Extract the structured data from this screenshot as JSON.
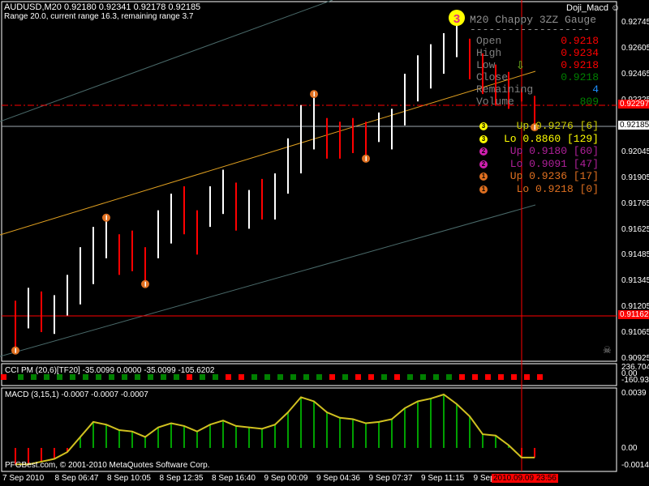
{
  "header": {
    "symbol_line": "AUDUSD,M20  0.92180 0.92341 0.92178 0.92185",
    "range_line": "Range 20.0, current range 16.3, remaining range 3.7",
    "expert": "Doji_Macd ☺"
  },
  "gauge": {
    "title": "M20 Chappy 3ZZ Gauge",
    "dash": "-------------------",
    "rows": [
      {
        "label": "Open",
        "value": "0.9218",
        "color": "#ff0000"
      },
      {
        "label": "High",
        "value": "0.9234",
        "color": "#ff0000"
      },
      {
        "label": "Low",
        "value": "0.9218",
        "color": "#ff0000"
      },
      {
        "label": "Close",
        "value": "0.9218",
        "color": "#008000"
      },
      {
        "label": "Remaining",
        "value": "4",
        "color": "#1e90ff"
      },
      {
        "label": "Volume",
        "value": "809",
        "color": "#008000"
      }
    ],
    "levels": [
      {
        "badge": "3",
        "text": "Up 0.9276 [6]",
        "color": "#cccc00",
        "badge_color": "#ffff00"
      },
      {
        "badge": "3",
        "text": "Lo 0.8860 [129]",
        "color": "#ffff00",
        "badge_color": "#ffff00"
      },
      {
        "badge": "2",
        "text": "Up 0.9180 [60]",
        "color": "#b0209a",
        "badge_color": "#d020b0"
      },
      {
        "badge": "2",
        "text": "Lo 0.9091 [47]",
        "color": "#b0209a",
        "badge_color": "#d020b0"
      },
      {
        "badge": "1",
        "text": "Up 0.9236 [17]",
        "color": "#e07020",
        "badge_color": "#e07020"
      },
      {
        "badge": "1",
        "text": "Lo 0.9218 [0]",
        "color": "#e07020",
        "badge_color": "#e07020"
      }
    ],
    "big_badge": "3"
  },
  "price_axis": [
    "0.92745",
    "0.92605",
    "0.92465",
    "0.92325",
    "0.92185",
    "0.92045",
    "0.91905",
    "0.91765",
    "0.91625",
    "0.91485",
    "0.91345",
    "0.91205",
    "0.91065",
    "0.90925"
  ],
  "price_tags": {
    "dashed": "0.92297",
    "current": "0.92185",
    "red": "0.91162"
  },
  "cci": {
    "label": "CCI PM (20,6)[TF20] -35.0099 0.0000 -35.0099 -105.6202",
    "axis": [
      "236.7045",
      "0.00",
      "-160.931"
    ],
    "colors": "rgggggggggggggrggrrggggggrgrrgrggggrrrrrrr"
  },
  "macd": {
    "label": "MACD (3,15,1) -0.0007 -0.0007 -0.0007",
    "axis": [
      "0.0039",
      "0.00",
      "-0.0014"
    ],
    "values": [
      -0.0012,
      -0.0012,
      -0.001,
      -0.0008,
      -0.0003,
      0.0008,
      0.0019,
      0.0017,
      0.0013,
      0.0012,
      0.0008,
      0.0015,
      0.0018,
      0.0016,
      0.0012,
      0.0017,
      0.002,
      0.0016,
      0.0015,
      0.0014,
      0.0017,
      0.0026,
      0.0037,
      0.0034,
      0.0026,
      0.0022,
      0.0021,
      0.0018,
      0.0019,
      0.0021,
      0.0029,
      0.0034,
      0.0036,
      0.0039,
      0.0032,
      0.0023,
      0.001,
      0.0009,
      0.0002,
      -0.0007,
      -0.0007
    ]
  },
  "copyright": "PFGBest.com, © 2001-2010 MetaQuotes Software Corp.",
  "time_axis": [
    "7 Sep 2010",
    "8 Sep 06:47",
    "8 Sep 10:05",
    "8 Sep 12:35",
    "8 Sep 16:40",
    "9 Sep 00:09",
    "9 Sep 04:36",
    "9 Sep 07:37",
    "9 Sep 11:15",
    "9 Sep"
  ],
  "time_cursor": "2010.09.09 23:56",
  "candles": [
    [
      0.9124,
      0.9096,
      0
    ],
    [
      0.9131,
      0.9109,
      1
    ],
    [
      0.9129,
      0.9107,
      0
    ],
    [
      0.9127,
      0.9106,
      1
    ],
    [
      0.9138,
      0.9116,
      1
    ],
    [
      0.9153,
      0.9122,
      1
    ],
    [
      0.9164,
      0.9133,
      1
    ],
    [
      0.9169,
      0.9147,
      1
    ],
    [
      0.916,
      0.9138,
      0
    ],
    [
      0.9162,
      0.914,
      0
    ],
    [
      0.9153,
      0.9132,
      0
    ],
    [
      0.9173,
      0.9147,
      1
    ],
    [
      0.9182,
      0.9155,
      1
    ],
    [
      0.9186,
      0.916,
      0
    ],
    [
      0.9173,
      0.9149,
      0
    ],
    [
      0.9186,
      0.9164,
      1
    ],
    [
      0.9195,
      0.9171,
      1
    ],
    [
      0.9188,
      0.9162,
      0
    ],
    [
      0.9184,
      0.9163,
      1
    ],
    [
      0.919,
      0.9168,
      0
    ],
    [
      0.9193,
      0.9168,
      1
    ],
    [
      0.9212,
      0.9182,
      1
    ],
    [
      0.923,
      0.9193,
      1
    ],
    [
      0.9236,
      0.9206,
      1
    ],
    [
      0.9223,
      0.9201,
      0
    ],
    [
      0.9221,
      0.9201,
      0
    ],
    [
      0.9223,
      0.9204,
      0
    ],
    [
      0.9221,
      0.9201,
      0
    ],
    [
      0.9226,
      0.921,
      1
    ],
    [
      0.9228,
      0.9206,
      1
    ],
    [
      0.9247,
      0.9219,
      1
    ],
    [
      0.9257,
      0.9232,
      1
    ],
    [
      0.9263,
      0.9239,
      1
    ],
    [
      0.9269,
      0.9247,
      1
    ],
    [
      0.9278,
      0.9256,
      1
    ],
    [
      0.9266,
      0.9244,
      0
    ],
    [
      0.9258,
      0.9236,
      0
    ],
    [
      0.9252,
      0.923,
      0
    ],
    [
      0.9248,
      0.9228,
      0
    ],
    [
      0.9239,
      0.9232,
      0
    ],
    [
      0.9235,
      0.9219,
      0
    ]
  ],
  "zigzag": [
    {
      "i": 0,
      "p": 0.9097
    },
    {
      "i": 7,
      "p": 0.9169
    },
    {
      "i": 10,
      "p": 0.9133
    },
    {
      "i": 23,
      "p": 0.9236
    },
    {
      "i": 27,
      "p": 0.9201
    },
    {
      "i": 40,
      "p": 0.9218
    }
  ]
}
